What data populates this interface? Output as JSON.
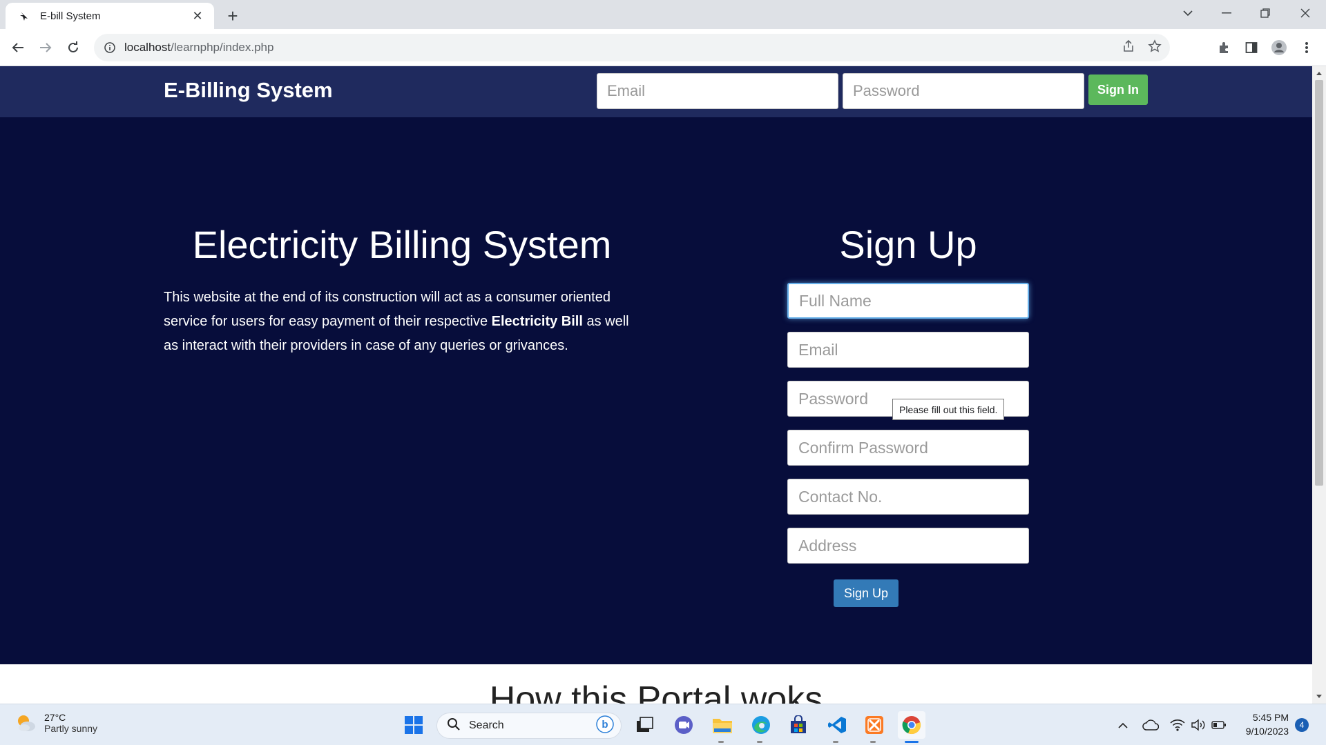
{
  "browser": {
    "tab_title": "E-bill System",
    "url_host": "localhost",
    "url_path": "/learnphp/index.php"
  },
  "site": {
    "brand": "E-Billing System",
    "nav": {
      "email_placeholder": "Email",
      "password_placeholder": "Password",
      "signin_label": "Sign In"
    },
    "hero": {
      "title": "Electricity Billing System",
      "text_before": "This website at the end of its construction will act as a consumer oriented service for users for easy payment of their respective ",
      "text_bold": "Electricity Bill",
      "text_after": " as well as interact with their providers in case of any queries or grivances."
    },
    "signup": {
      "title": "Sign Up",
      "fields": [
        {
          "placeholder": "Full Name"
        },
        {
          "placeholder": "Email"
        },
        {
          "placeholder": "Password"
        },
        {
          "placeholder": "Confirm Password"
        },
        {
          "placeholder": "Contact No."
        },
        {
          "placeholder": "Address"
        }
      ],
      "validation_tooltip": "Please fill out this field.",
      "button_label": "Sign Up"
    },
    "next_section_heading": "How this Portal woks"
  },
  "taskbar": {
    "weather_temp": "27°C",
    "weather_desc": "Partly sunny",
    "search_label": "Search",
    "time": "5:45 PM",
    "date": "9/10/2023",
    "notification_count": "4"
  },
  "colors": {
    "nav_bg": "#1f2a5e",
    "hero_bg": "#070d3b",
    "signin_green": "#5cb85c",
    "signup_blue": "#337ab7"
  }
}
